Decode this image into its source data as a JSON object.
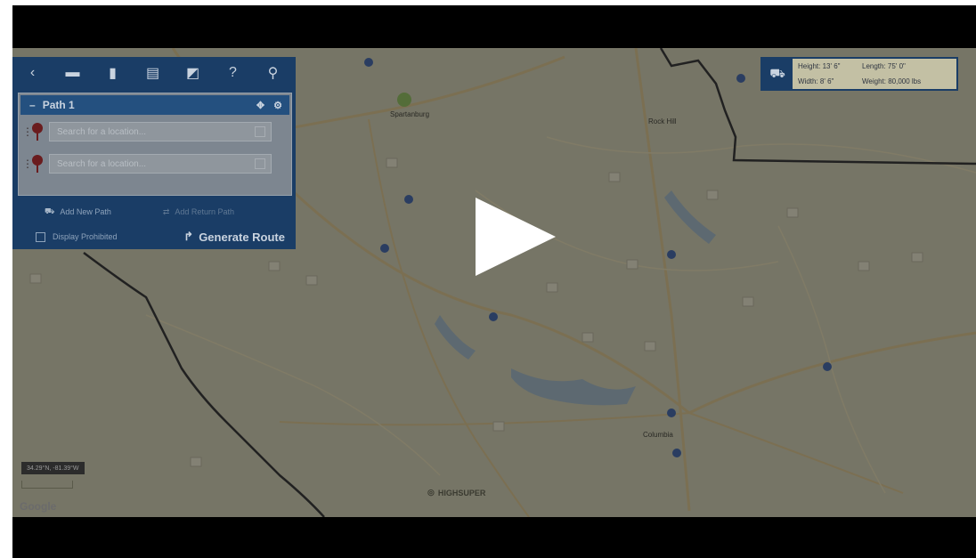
{
  "toolbar": {
    "icons": [
      "back-icon",
      "folder-icon",
      "trash-icon",
      "document-icon",
      "map-icon",
      "help-icon",
      "search-icon"
    ],
    "glyphs": [
      "‹",
      "▬",
      "▮",
      "▤",
      "◩",
      "?",
      "⚲"
    ]
  },
  "path": {
    "title": "Path 1",
    "caret": "–",
    "locations": [
      {
        "placeholder": "Search for a location..."
      },
      {
        "placeholder": "Search for a location..."
      }
    ]
  },
  "actions": {
    "add_new_path": "Add New Path",
    "add_return_path": "Add Return Path",
    "display_prohibited": "Display Prohibited",
    "generate_route": "Generate Route"
  },
  "truck_specs": {
    "height": "Height: 13' 6\"",
    "length": "Length: 75' 0\"",
    "width": "Width: 8' 6\"",
    "weight": "Weight: 80,000 lbs"
  },
  "map": {
    "cities": [
      "Spartanburg",
      "Rock Hill",
      "Columbia"
    ],
    "scale_label": "34.29°N, -81.39°W",
    "brand": "HIGHSUPER",
    "google": "Google"
  },
  "colors": {
    "panel": "#1a3d66",
    "path_header": "#24507f",
    "pin": "#6a1c1e"
  }
}
